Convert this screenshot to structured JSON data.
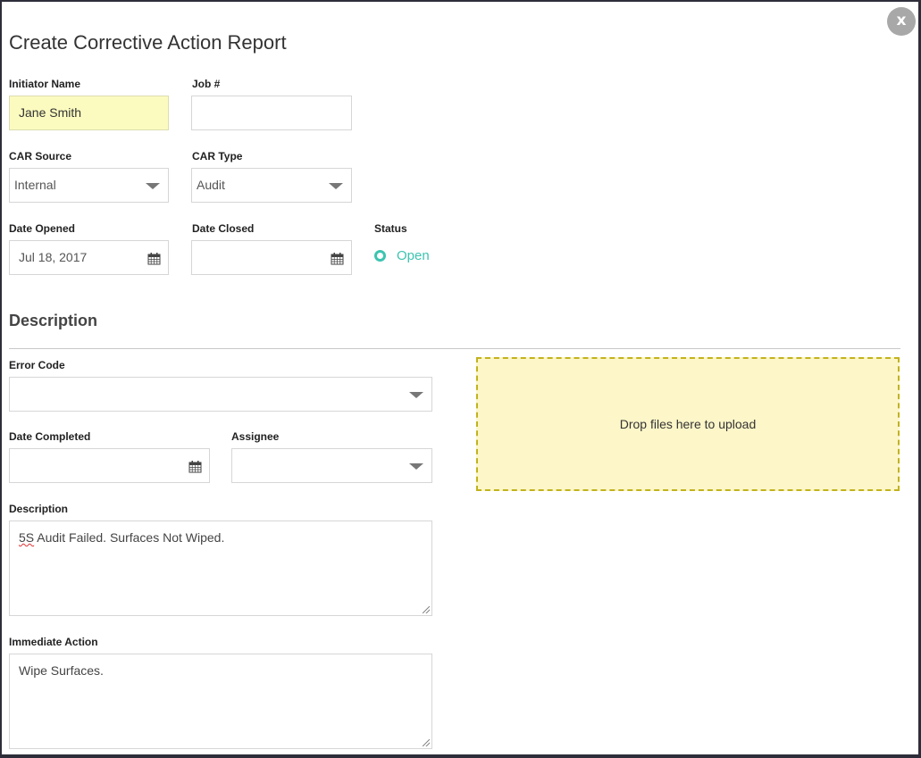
{
  "modal": {
    "title": "Create Corrective Action Report",
    "close_label": "x"
  },
  "fields": {
    "initiator_name": {
      "label": "Initiator Name",
      "value": "Jane Smith"
    },
    "job_number": {
      "label": "Job #",
      "value": ""
    },
    "car_source": {
      "label": "CAR Source",
      "value": "Internal"
    },
    "car_type": {
      "label": "CAR Type",
      "value": "Audit"
    },
    "date_opened": {
      "label": "Date Opened",
      "value": "Jul 18, 2017"
    },
    "date_closed": {
      "label": "Date Closed",
      "value": ""
    },
    "status": {
      "label": "Status",
      "value": "Open",
      "color": "#3cc4b0"
    }
  },
  "description_section": {
    "title": "Description",
    "error_code": {
      "label": "Error Code",
      "value": ""
    },
    "date_completed": {
      "label": "Date Completed",
      "value": ""
    },
    "assignee": {
      "label": "Assignee",
      "value": ""
    },
    "description": {
      "label": "Description",
      "misspelled_word": "5S",
      "rest": " Audit Failed. Surfaces Not Wiped."
    },
    "immediate_action": {
      "label": "Immediate Action",
      "value": "Wipe Surfaces."
    },
    "dropzone": {
      "text": "Drop files here to upload"
    }
  },
  "icons": {
    "close": "close-icon",
    "dropdown": "chevron-down-icon",
    "calendar": "calendar-icon",
    "status": "circle-ring-icon"
  }
}
